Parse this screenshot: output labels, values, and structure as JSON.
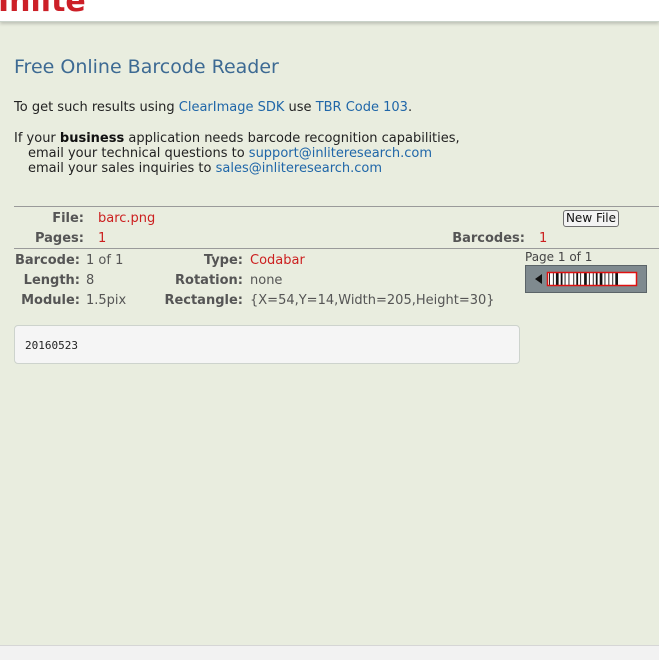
{
  "header": {
    "logo_text": "Inlite"
  },
  "page": {
    "title": "Free Online Barcode Reader"
  },
  "intro": {
    "prefix": "To get such results using ",
    "sdk_link": "ClearImage SDK",
    "middle": " use ",
    "code_link": "TBR Code 103",
    "suffix": "."
  },
  "business": {
    "prefix": "If your ",
    "bold": "business",
    "suffix": " application needs barcode recognition capabilities,",
    "tech_prefix": "email your technical questions to ",
    "tech_email": "support@inliteresearch.com",
    "sales_prefix": "email your sales inquiries to ",
    "sales_email": "sales@inliteresearch.com"
  },
  "file_info": {
    "file_label": "File:",
    "file_value": "barc.png",
    "pages_label": "Pages:",
    "pages_value": "1",
    "barcodes_label": "Barcodes:",
    "barcodes_value": "1",
    "new_file_button": "New File"
  },
  "barcode": {
    "barcode_label": "Barcode:",
    "barcode_value": "1 of 1",
    "length_label": "Length:",
    "length_value": "8",
    "module_label": "Module:",
    "module_value": "1.5pix",
    "type_label": "Type:",
    "type_value": "Codabar",
    "rotation_label": "Rotation:",
    "rotation_value": "none",
    "rectangle_label": "Rectangle:",
    "rectangle_value": "{X=54,Y=14,Width=205,Height=30}"
  },
  "preview": {
    "page_label": "Page 1 of 1"
  },
  "result": {
    "text": "20160523"
  },
  "colors": {
    "background": "#e9eddf",
    "accent_red": "#cc1f27",
    "link_blue": "#1f66a8",
    "title_blue": "#3d6a93"
  }
}
